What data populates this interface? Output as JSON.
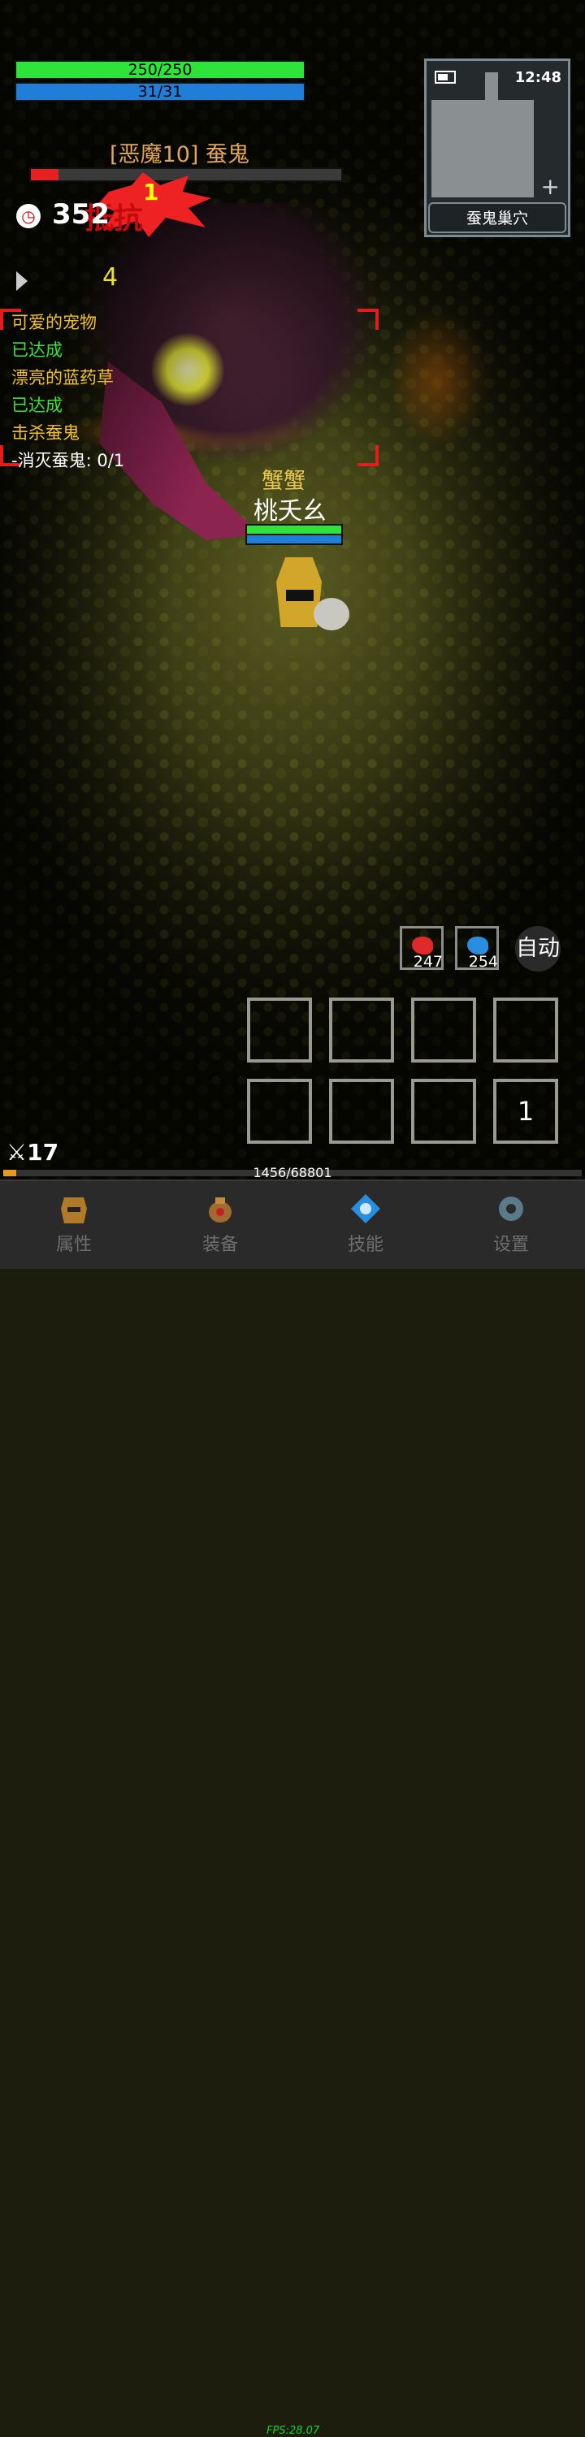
{
  "status": {
    "hp_text": "250/250",
    "mp_text": "31/31",
    "clock": "12:48",
    "timer_value": "352"
  },
  "boss": {
    "name": "[恶魔10] 蚕鬼",
    "hp_fraction": 0.09,
    "damage_number": "1",
    "resist_text": "抵抗",
    "floating_number": "4"
  },
  "minimap": {
    "location": "蚕鬼巢穴"
  },
  "quests": [
    {
      "title": "可爱的宠物",
      "status": "已达成"
    },
    {
      "title": "漂亮的蓝药草",
      "status": "已达成"
    },
    {
      "title": "击杀蚕鬼",
      "status": "-消灭蚕鬼: 0/1"
    }
  ],
  "player": {
    "pet_name": "蟹蟹",
    "name": "桃夭幺"
  },
  "potions": {
    "hp_count": "247",
    "mp_count": "254",
    "auto_label": "自动",
    "hp_color": "#e02a2a",
    "mp_color": "#2a8ee0"
  },
  "skills": {
    "slot_8_count": "1"
  },
  "level": {
    "value": "17",
    "xp_text": "1456/68801"
  },
  "nav": {
    "attributes": "属性",
    "equipment": "装备",
    "skills": "技能",
    "settings": "设置",
    "fps": "FPS:28.07"
  }
}
